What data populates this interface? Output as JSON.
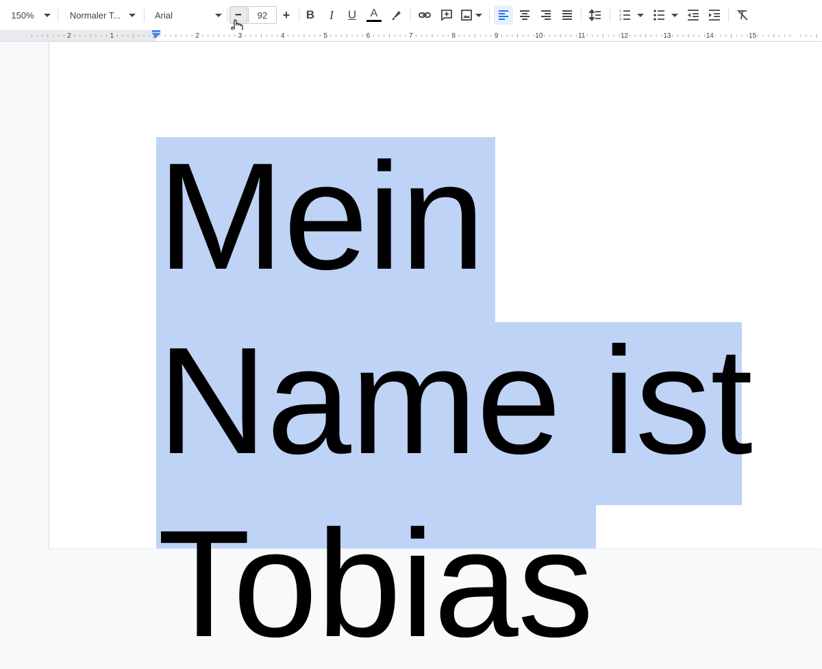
{
  "toolbar": {
    "zoom": "150%",
    "style": "Normaler T...",
    "font": "Arial",
    "font_size": "92",
    "decrease_label": "−",
    "increase_label": "+",
    "bold_label": "B",
    "italic_label": "I",
    "underline_label": "U",
    "text_color_label": "A",
    "icons": [
      "chevron-down-icon",
      "minus-icon",
      "plus-icon",
      "bold-icon",
      "italic-icon",
      "underline-icon",
      "text-color-icon",
      "highlight-icon",
      "link-icon",
      "comment-icon",
      "image-icon",
      "align-left-icon",
      "align-center-icon",
      "align-right-icon",
      "justify-icon",
      "line-spacing-icon",
      "numbered-list-icon",
      "bulleted-list-icon",
      "decrease-indent-icon",
      "increase-indent-icon",
      "clear-formatting-icon"
    ]
  },
  "ruler": {
    "labels": [
      "2",
      "1",
      "1",
      "2",
      "3",
      "4",
      "5",
      "6",
      "7",
      "8",
      "9",
      "10",
      "11",
      "12",
      "13",
      "14",
      "15"
    ]
  },
  "document": {
    "lines": [
      "Mein",
      "Name ist",
      "Tobias"
    ]
  },
  "colors": {
    "selection": "#bfd3f6",
    "accent": "#1a73e8",
    "icon": "#444746",
    "active_button": "#e8f0fe"
  }
}
